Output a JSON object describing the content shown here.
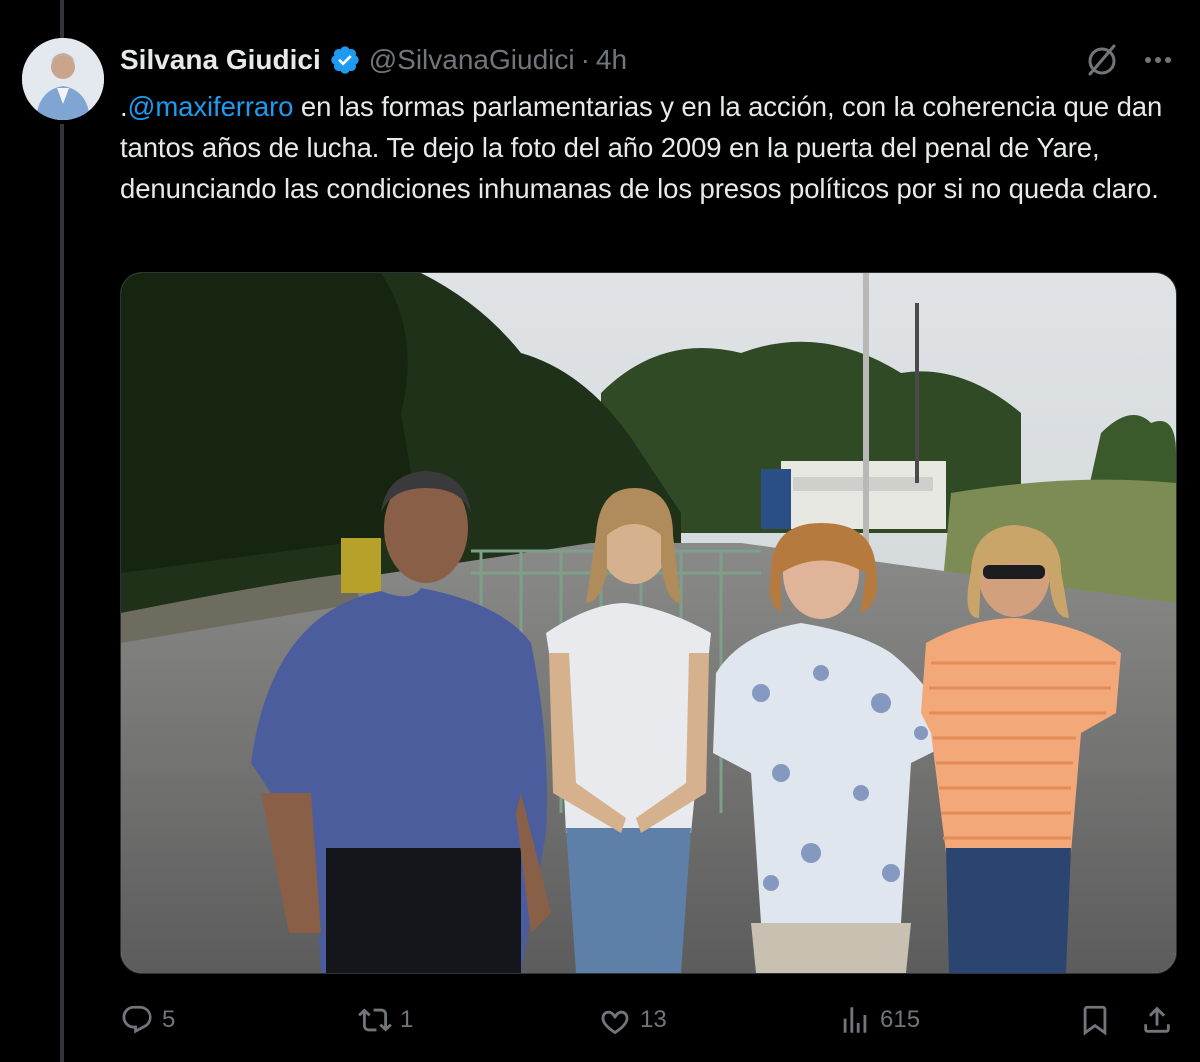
{
  "tweet": {
    "author_name": "Silvana Giudici",
    "handle": "@SilvanaGiudici",
    "separator": "·",
    "time": "4h",
    "text_prefix": ".",
    "mention": "@maxiferraro",
    "text_body": " en las formas parlamentarias y en la acción, con la coherencia que dan tantos años de lucha. Te dejo la foto del año 2009 en la puerta del penal de Yare, denunciando las condiciones inhumanas de los presos políticos por si no queda claro."
  },
  "icons": {
    "verified": "verified-badge-icon",
    "grok": "grok-icon",
    "more": "more-icon",
    "reply": "reply-icon",
    "retweet": "retweet-icon",
    "like": "like-icon",
    "views": "views-icon",
    "bookmark": "bookmark-icon",
    "share": "share-icon"
  },
  "stats": {
    "replies": "5",
    "retweets": "1",
    "likes": "13",
    "views": "615"
  },
  "colors": {
    "background": "#000000",
    "text": "#e7e9ea",
    "muted": "#71767b",
    "accent": "#1d9bf0"
  }
}
